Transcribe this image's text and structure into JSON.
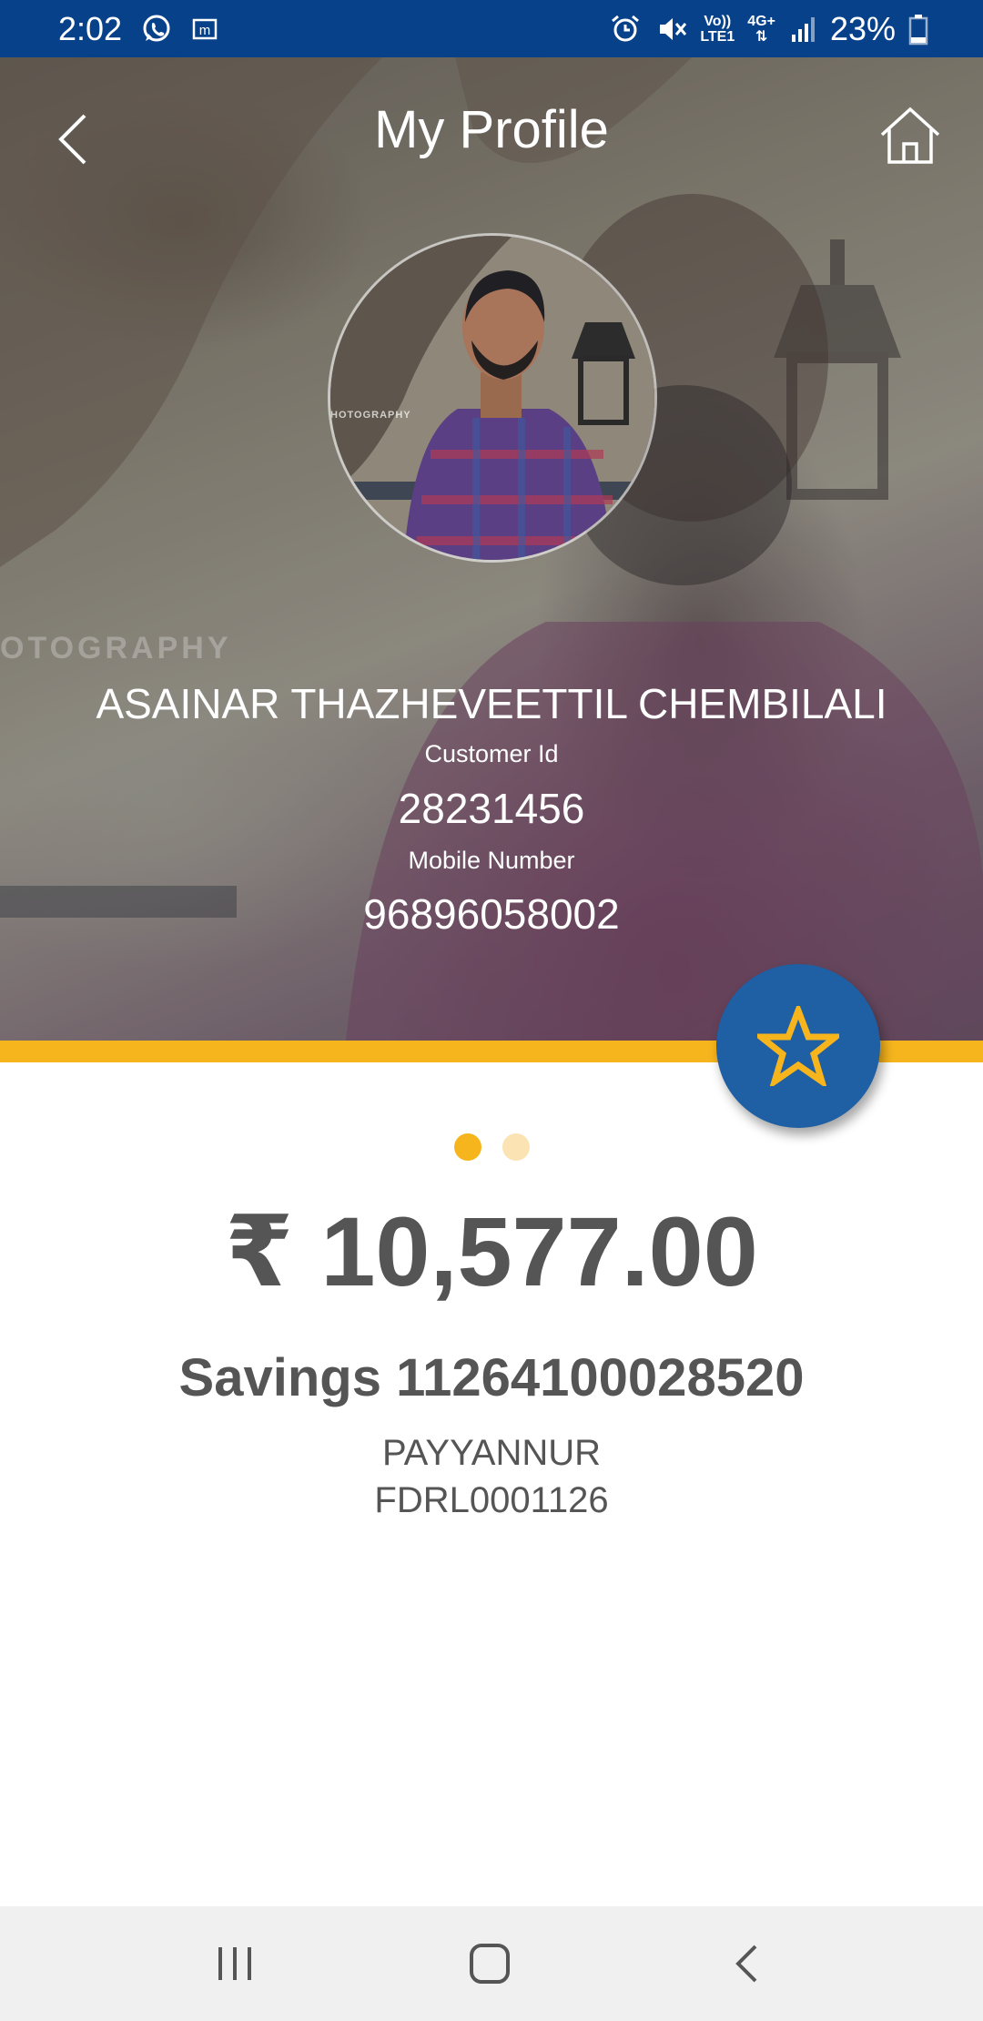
{
  "status_bar": {
    "time": "2:02",
    "network_top": "Vo))",
    "network_bottom": "LTE1",
    "data_type": "4G+",
    "battery": "23%"
  },
  "header": {
    "title": "My Profile"
  },
  "profile": {
    "name": "ASAINAR THAZHEVEETTIL CHEMBILALI",
    "customer_id_label": "Customer Id",
    "customer_id": "28231456",
    "mobile_label": "Mobile Number",
    "mobile": "96896058002"
  },
  "account_card": {
    "balance": "₹ 10,577.00",
    "account": "Savings 11264100028520",
    "branch": "PAYYANNUR",
    "ifsc": "FDRL0001126",
    "page_count": 2,
    "active_page": 0
  },
  "colors": {
    "status_bar": "#06418a",
    "accent": "#f7b51d",
    "fab": "#1f5fa3",
    "text_dark": "#555555"
  },
  "icons": {
    "back": "chevron-left-icon",
    "home": "home-icon",
    "favorite": "star-icon",
    "nav_recents": "recents-icon",
    "nav_home": "home-square-icon",
    "nav_back": "back-icon"
  }
}
